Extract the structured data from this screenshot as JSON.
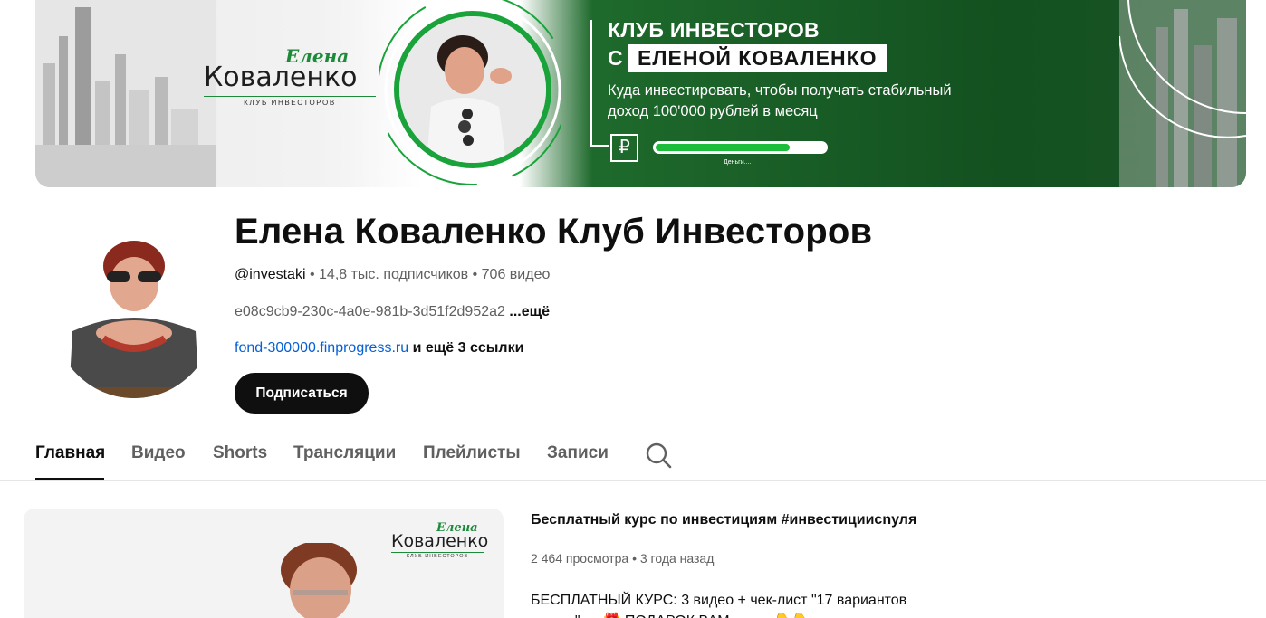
{
  "banner": {
    "logo_script": "Елена",
    "logo_surname": "Коваленко",
    "logo_sub": "КЛУБ ИНВЕСТОРОВ",
    "title_line1": "КЛУБ ИНВЕСТОРОВ",
    "title_prefix": "С",
    "title_line2": "ЕЛЕНОЙ КОВАЛЕНКО",
    "description": "Куда инвестировать, чтобы получать стабильный доход 100'000 рублей в месяц",
    "currency_icon": "ruble-icon",
    "currency_symbol": "₽",
    "progress": 0.79,
    "progress_caption": "Деньги....",
    "accent_color": "#1aa33b"
  },
  "channel": {
    "title": "Елена Коваленко Клуб Инвесторов",
    "handle": "@investaki",
    "subscribers": "14,8 тыс. подписчиков",
    "video_count": "706 видео",
    "separator": "•",
    "description": "e08c9cb9-230c-4a0e-981b-3d51f2d952a2",
    "description_more": "...ещё",
    "link": "fond-300000.finprogress.ru",
    "links_more": "и ещё 3 ссылки",
    "subscribe_label": "Подписаться"
  },
  "tabs": [
    {
      "label": "Главная",
      "active": true
    },
    {
      "label": "Видео",
      "active": false
    },
    {
      "label": "Shorts",
      "active": false
    },
    {
      "label": "Трансляции",
      "active": false
    },
    {
      "label": "Плейлисты",
      "active": false
    },
    {
      "label": "Записи",
      "active": false
    }
  ],
  "search_icon": "search-icon",
  "featured": {
    "thumb_script": "Елена",
    "thumb_surname": "Коваленко",
    "thumb_sub": "КЛУБ ИНВЕСТОРОВ",
    "title": "Бесплатный курс по инвестициям #инвестициисnуля",
    "views": "2 464 просмотра",
    "age": "3 года назад",
    "desc_line1": "БЕСПЛАТНЫЙ КУРС: 3 видео + чек-лист \"17 вариантов",
    "desc_line2": "...........\" — 🎁 ПОДАРОК ВАМ ..........👇👇"
  }
}
